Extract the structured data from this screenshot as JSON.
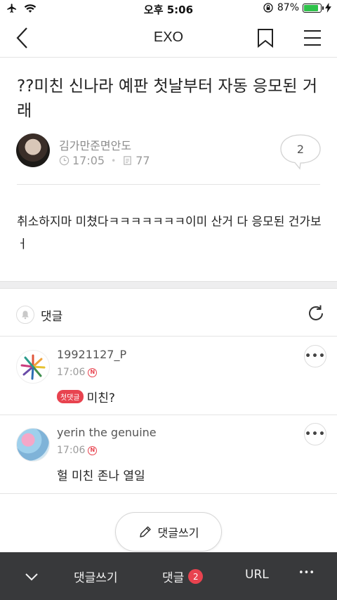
{
  "status_bar": {
    "time": "오후 5:06",
    "battery_percent": "87%",
    "battery_level": 0.87,
    "battery_color": "#2ec24a"
  },
  "nav": {
    "title": "EXO",
    "back_icon": "chevron-left-icon",
    "bookmark_icon": "bookmark-icon",
    "menu_icon": "hamburger-menu-icon"
  },
  "post": {
    "title": "??미친 신나라 예판 첫날부터 자동 응모된 거래",
    "author": "김가만준면안도",
    "time": "17:05",
    "views": "77",
    "comment_count": "2",
    "body": "취소하지마 미쳤다ㅋㅋㅋㅋㅋㅋㅋ이미 산거 다 응모된 건가보 ㅓ"
  },
  "comments_section": {
    "label": "댓글",
    "comments": [
      {
        "author": "19921127_P",
        "time": "17:06",
        "new_badge": "N",
        "first_badge": "첫댓글",
        "text": "미친?"
      },
      {
        "author": "yerin the genuine",
        "time": "17:06",
        "new_badge": "N",
        "text": "헐 미친 존나 열일"
      }
    ],
    "more_label": "•••"
  },
  "write_button": {
    "label": "댓글쓰기"
  },
  "bottom_bar": {
    "write_label": "댓글쓰기",
    "comments_label": "댓글",
    "comments_count": "2",
    "url_label": "URL",
    "more_label": "•••"
  },
  "colors": {
    "accent_red": "#e8434f",
    "toolbar_bg": "#38393b"
  }
}
